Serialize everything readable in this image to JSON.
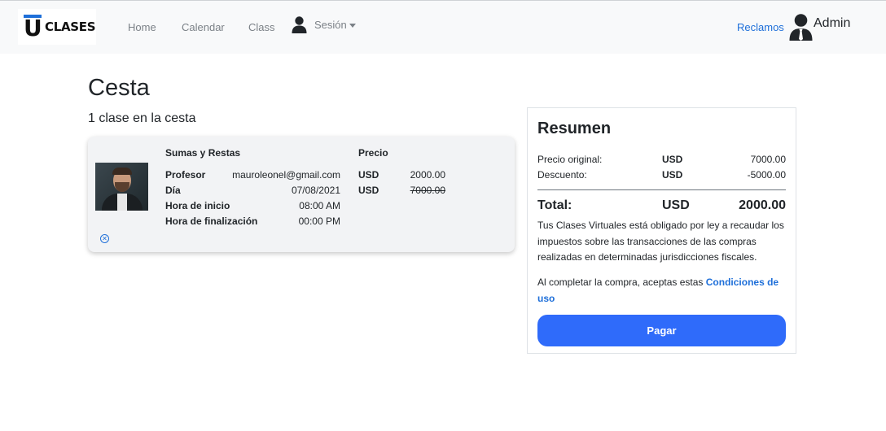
{
  "navbar": {
    "brand_text": "CLASES",
    "brand_letter": "U",
    "links": {
      "home": "Home",
      "calendar": "Calendar",
      "class": "Class"
    },
    "session_label": "Sesión",
    "reclamos": "Reclamos",
    "admin_name": "Admin",
    "icons": {
      "session": "user-icon",
      "admin": "user-tie-icon",
      "caret": "caret-down-icon"
    }
  },
  "page": {
    "title": "Cesta",
    "cart_count": "1 clase en la cesta"
  },
  "cart_item": {
    "name": "Sumas y Restas",
    "price_header": "Precio",
    "rows": [
      {
        "label": "Profesor",
        "value": "mauroleonel@gmail.com"
      },
      {
        "label": "Día",
        "value": "07/08/2021"
      },
      {
        "label": "Hora de inicio",
        "value": "08:00 AM"
      },
      {
        "label": "Hora de finalización",
        "value": "00:00 PM"
      }
    ],
    "price": {
      "currency": "USD",
      "amount": "2000.00"
    },
    "original_price": {
      "currency": "USD",
      "amount": "7000.00"
    },
    "remove_icon": "remove-circle-icon"
  },
  "summary": {
    "title": "Resumen",
    "original": {
      "label": "Precio original:",
      "currency": "USD",
      "value": "7000.00"
    },
    "discount": {
      "label": "Descuento:",
      "currency": "USD",
      "value": "-5000.00"
    },
    "total": {
      "label": "Total:",
      "currency": "USD",
      "value": "2000.00"
    },
    "tax_note": "Tus Clases Virtuales está obligado por ley a recaudar los impuestos sobre las transacciones de las compras realizadas en determinadas jurisdicciones fiscales.",
    "terms_prefix": "Al completar la compra, aceptas estas ",
    "terms_link": "Condiciones de uso",
    "pay_button": "Pagar"
  },
  "colors": {
    "primary": "#2f6bfa",
    "link": "#1e6fd9",
    "navbar_bg": "#f8f9fa"
  }
}
